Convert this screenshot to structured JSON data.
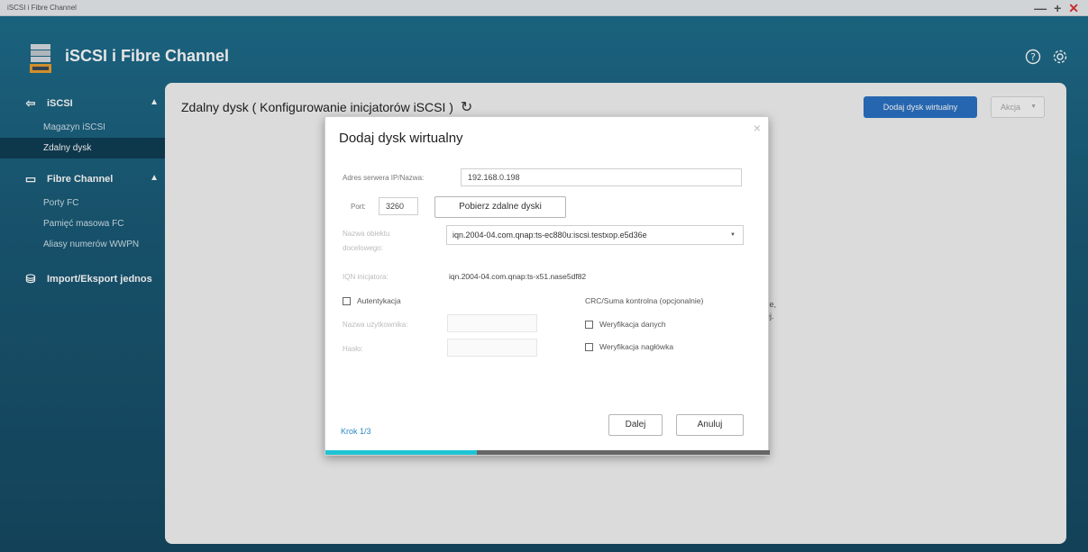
{
  "window": {
    "title": "iSCSI i Fibre Channel",
    "min": "—",
    "max": "+",
    "close": "✕"
  },
  "app": {
    "title": "iSCSI i Fibre Channel",
    "help_icon": "help-icon",
    "settings_icon": "gear-icon"
  },
  "sidebar": {
    "groups": [
      {
        "label": "iSCSI",
        "icon": "iscsi-arrow-icon",
        "items": [
          {
            "label": "Magazyn iSCSI"
          },
          {
            "label": "Zdalny dysk",
            "active": true
          }
        ]
      },
      {
        "label": "Fibre Channel",
        "icon": "fibre-channel-icon",
        "items": [
          {
            "label": "Porty FC"
          },
          {
            "label": "Pamięć masowa FC"
          },
          {
            "label": "Aliasy numerów WWPN"
          }
        ]
      },
      {
        "label": "Import/Eksport jednos",
        "icon": "storage-icon",
        "items": []
      }
    ]
  },
  "main": {
    "title": "Zdalny dysk ( Konfigurowanie inicjatorów iSCSI )",
    "add_button": "Dodaj dysk wirtualny",
    "action_button": "Akcja",
    "bg_fragment_1": "ze,",
    "bg_fragment_2": "ej."
  },
  "dialog": {
    "title": "Dodaj dysk wirtualny",
    "close": "×",
    "server_label": "Adres serwera IP/Nazwa:",
    "server_value": "192.168.0.198",
    "port_label": "Port:",
    "port_value": "3260",
    "fetch_button": "Pobierz zdalne dyski",
    "target_label_1": "Nazwa obiektu",
    "target_label_2": "docelowego:",
    "target_value": "iqn.2004-04.com.qnap:ts-ec880u:iscsi.testxop.e5d36e",
    "initiator_label": "IQN inicjatora:",
    "initiator_value": "iqn.2004-04.com.qnap:ts-x51.nase5df82",
    "auth_label": "Autentykacja",
    "username_label": "Nazwa użytkownika:",
    "password_label": "Hasło:",
    "crc_label": "CRC/Suma kontrolna (opcjonalnie)",
    "data_verify_label": "Weryfikacja danych",
    "header_verify_label": "Weryfikacja nagłówka",
    "step_label": "Krok 1/3",
    "next_button": "Dalej",
    "cancel_button": "Anuluj",
    "progress": 0.34
  }
}
